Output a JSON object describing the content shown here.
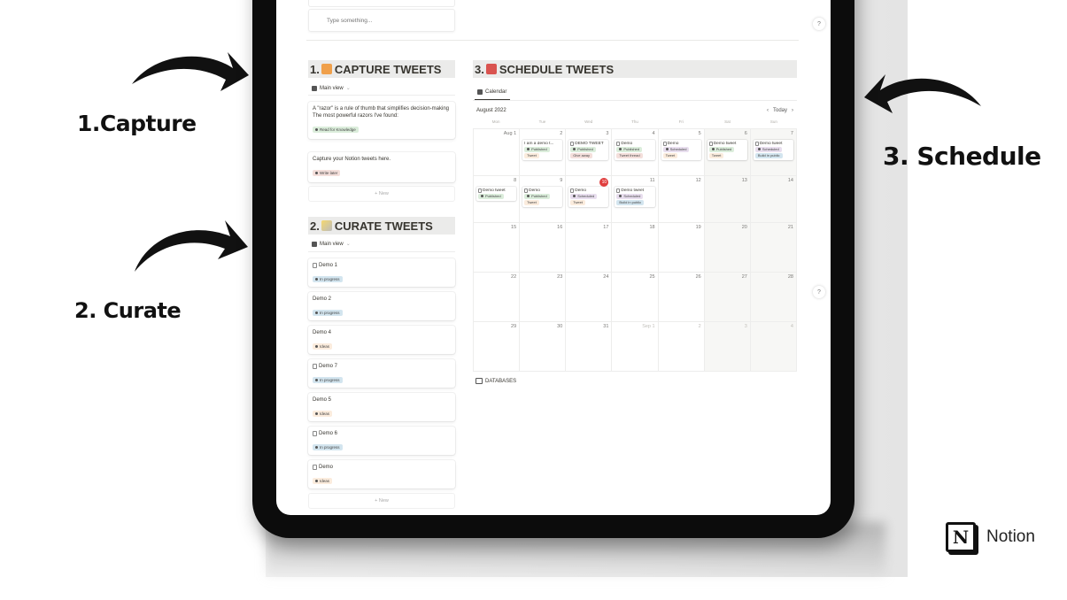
{
  "annotations": {
    "capture": "1.Capture",
    "curate": "2. Curate",
    "schedule": "3. Schedule"
  },
  "brand": {
    "name": "Notion",
    "logo_letter": "N"
  },
  "top": {
    "type_placeholder": "Type something...",
    "help_label": "?"
  },
  "capture": {
    "number": "1.",
    "title": "CAPTURE TWEETS",
    "emoji_color": "#f0a04b",
    "view_label": "Main view",
    "cards": [
      {
        "title": "A \"razor\" is a rule of thumb that simplifies decision-making\nThe most powerful razors I've found:",
        "tag": "Read for Knowledge",
        "tag_color": "#dbeddb"
      },
      {
        "title": "Capture your Notion tweets here.",
        "tag": "Write later",
        "tag_color": "#f4dfdb"
      }
    ],
    "new_label": "+ New"
  },
  "curate": {
    "number": "2.",
    "title": "CURATE TWEETS",
    "view_label": "Main view",
    "cards": [
      {
        "title": "Demo 1",
        "icon": true,
        "tag": "In progress",
        "tag_color": "#d3e5ef"
      },
      {
        "title": "Demo 2",
        "icon": false,
        "tag": "In progress",
        "tag_color": "#d3e5ef"
      },
      {
        "title": "Demo 4",
        "icon": false,
        "tag": "Ideas",
        "tag_color": "#fbecdd"
      },
      {
        "title": "Demo 7",
        "icon": true,
        "tag": "In progress",
        "tag_color": "#d3e5ef"
      },
      {
        "title": "Demo 5",
        "icon": false,
        "tag": "Ideas",
        "tag_color": "#fbecdd"
      },
      {
        "title": "Demo 6",
        "icon": true,
        "tag": "In progress",
        "tag_color": "#d3e5ef"
      },
      {
        "title": "Demo",
        "icon": true,
        "tag": "Ideas",
        "tag_color": "#fbecdd"
      }
    ],
    "new_label": "+ New"
  },
  "schedule": {
    "number": "3.",
    "title": "SCHEDULE TWEETS",
    "view_label": "Calendar",
    "month": "August 2022",
    "today_label": "Today",
    "prev_label": "‹",
    "next_label": "›",
    "weekdays": [
      "Mon",
      "Tue",
      "Wed",
      "Thu",
      "Fri",
      "Sat",
      "Sun"
    ],
    "weeks": [
      [
        {
          "day": "Aug 1",
          "events": []
        },
        {
          "day": "2",
          "events": [
            {
              "title": "I am a demo t...",
              "icon": false,
              "status": "Published",
              "status_color": "#dbeddb",
              "type": "Tweet",
              "type_color": "#fbecdd"
            }
          ]
        },
        {
          "day": "3",
          "events": [
            {
              "title": "DEMO TWEET",
              "icon": true,
              "status": "Published",
              "status_color": "#dbeddb",
              "type": "Give away",
              "type_color": "#f4dfdb"
            }
          ]
        },
        {
          "day": "4",
          "events": [
            {
              "title": "Demo",
              "icon": true,
              "status": "Published",
              "status_color": "#dbeddb",
              "type": "Tweet thread",
              "type_color": "#f4dfdb"
            }
          ]
        },
        {
          "day": "5",
          "events": [
            {
              "title": "Demo",
              "icon": true,
              "status": "Scheduled",
              "status_color": "#e8deee",
              "type": "Tweet",
              "type_color": "#fbecdd"
            }
          ]
        },
        {
          "day": "6",
          "weekend": true,
          "events": [
            {
              "title": "Demo tweet",
              "icon": true,
              "status": "Published",
              "status_color": "#dbeddb",
              "type": "Tweet",
              "type_color": "#fbecdd"
            }
          ]
        },
        {
          "day": "7",
          "weekend": true,
          "events": [
            {
              "title": "Demo tweet",
              "icon": true,
              "status": "Scheduled",
              "status_color": "#e8deee",
              "type": "Build in public",
              "type_color": "#d3e5ef"
            }
          ]
        }
      ],
      [
        {
          "day": "8",
          "events": [
            {
              "title": "Demo tweet",
              "icon": true,
              "status": "Published",
              "status_color": "#dbeddb"
            }
          ]
        },
        {
          "day": "9",
          "events": [
            {
              "title": "Demo",
              "icon": true,
              "status": "Published",
              "status_color": "#dbeddb",
              "type": "Tweet",
              "type_color": "#fbecdd"
            }
          ]
        },
        {
          "day": "10",
          "today": true,
          "events": [
            {
              "title": "Demo",
              "icon": true,
              "status": "Scheduled",
              "status_color": "#e8deee",
              "type": "Tweet",
              "type_color": "#fbecdd"
            }
          ]
        },
        {
          "day": "11",
          "events": [
            {
              "title": "Demo tweet",
              "icon": true,
              "status": "Scheduled",
              "status_color": "#e8deee",
              "type": "Build in public",
              "type_color": "#d3e5ef"
            }
          ]
        },
        {
          "day": "12",
          "events": []
        },
        {
          "day": "13",
          "weekend": true,
          "events": []
        },
        {
          "day": "14",
          "weekend": true,
          "events": []
        }
      ],
      [
        {
          "day": "15",
          "events": []
        },
        {
          "day": "16",
          "events": []
        },
        {
          "day": "17",
          "events": []
        },
        {
          "day": "18",
          "events": []
        },
        {
          "day": "19",
          "events": []
        },
        {
          "day": "20",
          "weekend": true,
          "events": []
        },
        {
          "day": "21",
          "weekend": true,
          "events": []
        }
      ],
      [
        {
          "day": "22",
          "events": []
        },
        {
          "day": "23",
          "events": []
        },
        {
          "day": "24",
          "events": []
        },
        {
          "day": "25",
          "events": []
        },
        {
          "day": "26",
          "events": []
        },
        {
          "day": "27",
          "weekend": true,
          "events": []
        },
        {
          "day": "28",
          "weekend": true,
          "events": []
        }
      ],
      [
        {
          "day": "29",
          "events": []
        },
        {
          "day": "30",
          "events": []
        },
        {
          "day": "31",
          "events": []
        },
        {
          "day": "Sep 1",
          "other": true,
          "events": []
        },
        {
          "day": "2",
          "other": true,
          "events": []
        },
        {
          "day": "3",
          "other": true,
          "weekend": true,
          "events": []
        },
        {
          "day": "4",
          "other": true,
          "weekend": true,
          "events": []
        }
      ]
    ],
    "databases_label": "DATABASES"
  }
}
